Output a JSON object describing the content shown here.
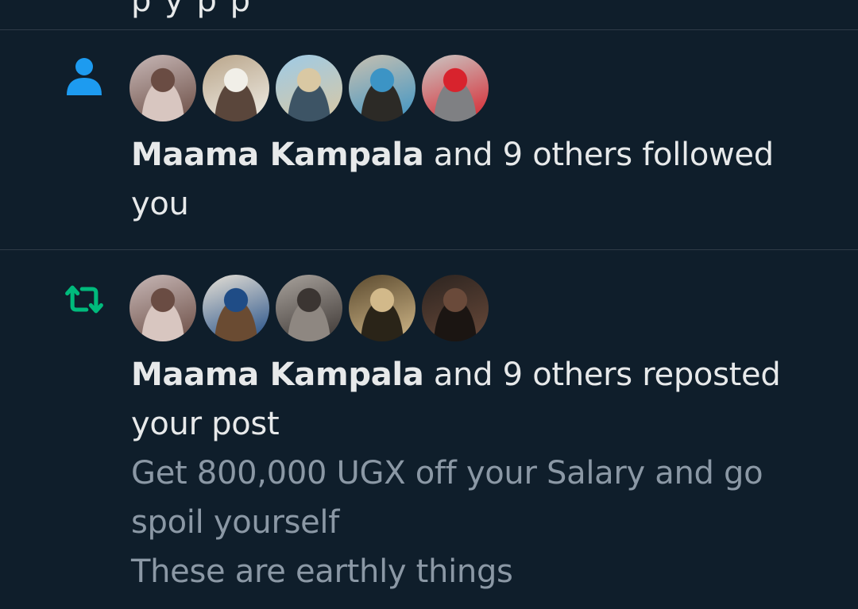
{
  "top_strip": {
    "clipped_text": "p               y   p               p"
  },
  "notifications": [
    {
      "type": "follow",
      "icon": "person-icon",
      "icon_color": "#1d9bf0",
      "actor_name": "Maama Kampala",
      "summary_suffix": " and 9 others followed you",
      "avatars": [
        {
          "name": "avatar-1",
          "colors": [
            "#c7b7b6",
            "#6a4c43",
            "#d8c6c0"
          ]
        },
        {
          "name": "avatar-2",
          "colors": [
            "#b9a58a",
            "#f1efe8",
            "#5a463b"
          ]
        },
        {
          "name": "avatar-3",
          "colors": [
            "#9ecae6",
            "#d9c8a3",
            "#3d5465"
          ]
        },
        {
          "name": "avatar-4",
          "colors": [
            "#c8c0b0",
            "#3c94c5",
            "#2c2a26"
          ]
        },
        {
          "name": "avatar-5",
          "colors": [
            "#c9c7c4",
            "#d8232d",
            "#7f8083"
          ]
        }
      ]
    },
    {
      "type": "repost",
      "icon": "repost-icon",
      "icon_color": "#00ba7c",
      "actor_name": "Maama Kampala",
      "summary_suffix": " and 9 others reposted your post",
      "avatars": [
        {
          "name": "avatar-1",
          "colors": [
            "#c7b7b6",
            "#6a4c43",
            "#d8c6c0"
          ]
        },
        {
          "name": "avatar-2",
          "colors": [
            "#e7e1d6",
            "#1f4c86",
            "#6a4b32"
          ]
        },
        {
          "name": "avatar-3",
          "colors": [
            "#a8a29c",
            "#3b3532",
            "#8e8781"
          ]
        },
        {
          "name": "avatar-4",
          "colors": [
            "#5b4a2f",
            "#d2b98a",
            "#2a2418"
          ]
        },
        {
          "name": "avatar-5",
          "colors": [
            "#2c2420",
            "#6a4a3a",
            "#1b1512"
          ]
        }
      ],
      "post_lines": [
        "Get 800,000 UGX off your Salary and go spoil yourself",
        "These are earthly things"
      ]
    }
  ]
}
